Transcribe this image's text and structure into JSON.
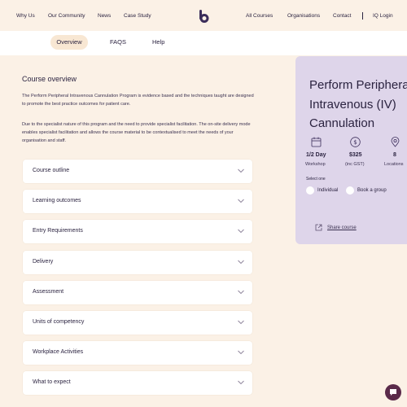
{
  "nav": {
    "left": [
      "Why Us",
      "Our Community",
      "News",
      "Case Study"
    ],
    "right": [
      "All Courses",
      "Organisations",
      "Contact"
    ],
    "separator": "|",
    "login": "IQ Login",
    "logo_icon": "b-logo-icon"
  },
  "tabs": {
    "overview": "Overview",
    "faqs": "FAQS",
    "help": "Help",
    "active": "Overview"
  },
  "content": {
    "heading": "Course overview",
    "para1": "The Perform Peripheral Intravenous Cannulation Program is evidence based and the techniques taught are designed to promote the best practice outcomes for patient care.",
    "para2": "Due to the specialist nature of this program and the need to provide specialist facilitation. The on-site delivery mode enables specialist facilitation and allows the course material to be contextualised to meet the needs of your organisation and staff."
  },
  "accordion": [
    "Course outline",
    "Learning outcomes",
    "Entry Requirements",
    "Delivery",
    "Assessment",
    "Units of competency",
    "Workplace Activities",
    "What to expect"
  ],
  "card": {
    "title_lines": [
      "Perform Peripheral",
      "Intravenous (IV)",
      "Cannulation"
    ],
    "stats": [
      {
        "icon": "calendar-icon",
        "value": "1/2 Day",
        "sub": "Workshop"
      },
      {
        "icon": "dollar-icon",
        "value": "$325",
        "sub": "(inc GST)"
      },
      {
        "icon": "location-pin-icon",
        "value": "8",
        "sub": "Locations"
      }
    ],
    "select_label": "Select one",
    "options": [
      "Individual",
      "Book a group"
    ],
    "share": "Share course"
  },
  "colors": {
    "background": "#fbf1e6",
    "card": "#ded5ea",
    "tab_active": "#f8e7d3",
    "text": "#2b2340",
    "chat": "#5a2a4a"
  }
}
